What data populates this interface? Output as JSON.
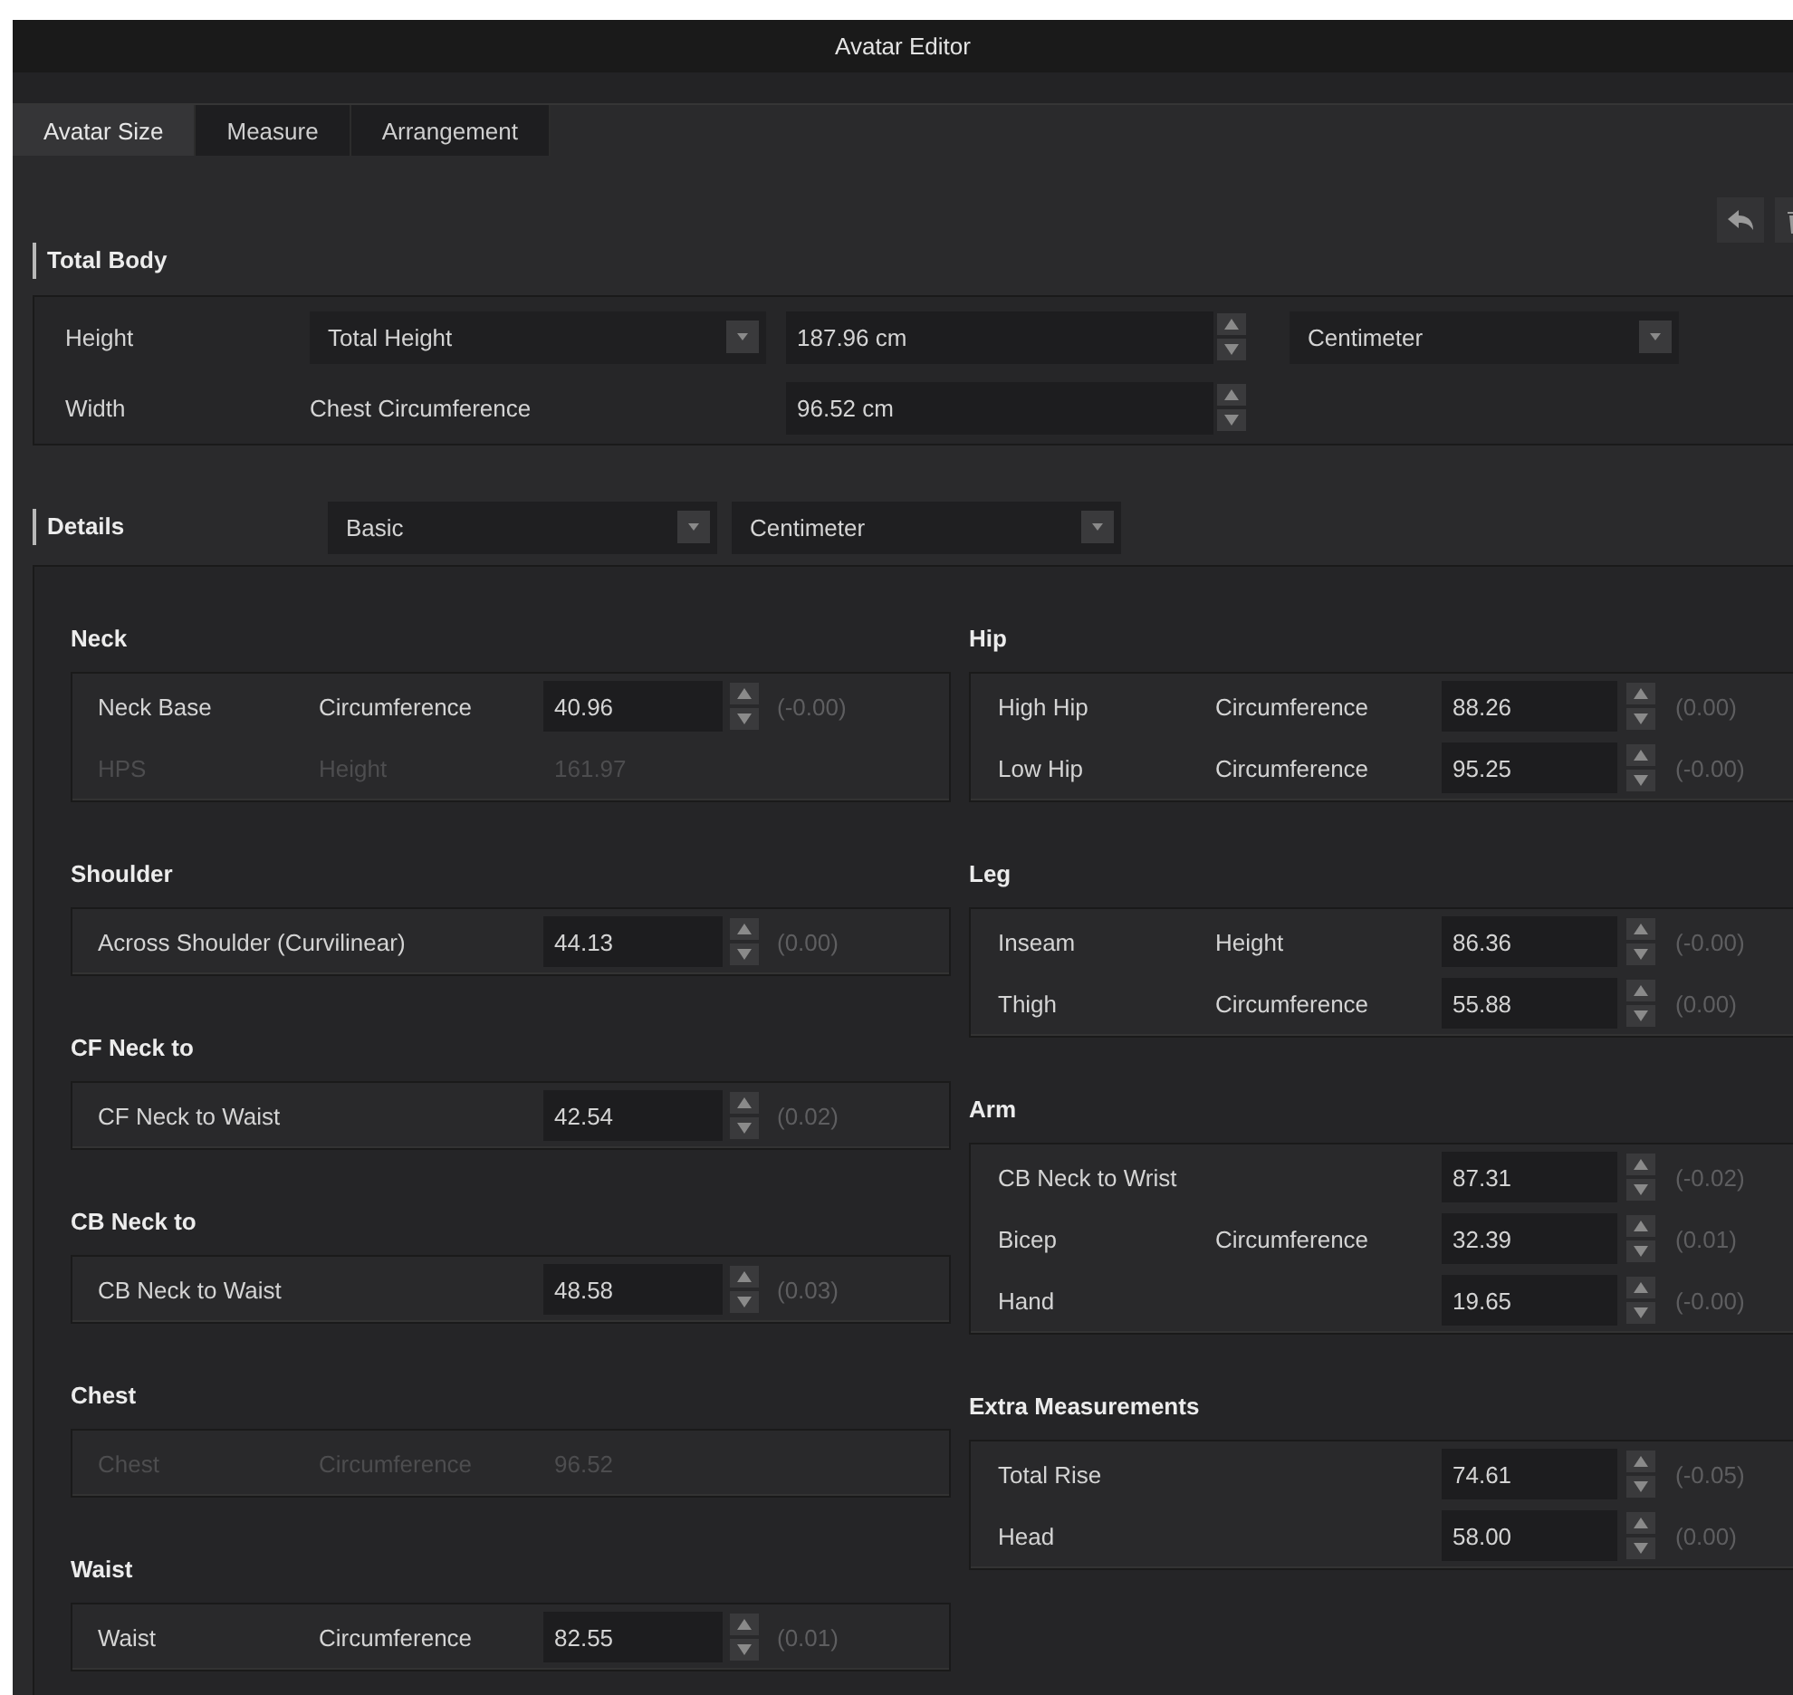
{
  "window": {
    "title": "Avatar Editor"
  },
  "tabs": [
    {
      "label": "Avatar Size",
      "selected": true
    },
    {
      "label": "Measure",
      "selected": false
    },
    {
      "label": "Arrangement",
      "selected": false
    }
  ],
  "total_body": {
    "title": "Total Body",
    "rows": [
      {
        "label": "Height",
        "kind": "dropdown",
        "measure": "Total Height",
        "value": "187.96 cm",
        "unit": "Centimeter"
      },
      {
        "label": "Width",
        "kind": "text",
        "measure": "Chest Circumference",
        "value": "96.52 cm"
      }
    ]
  },
  "details": {
    "title": "Details",
    "preset": "Basic",
    "unit": "Centimeter",
    "left": [
      {
        "title": "Neck",
        "rows": [
          {
            "name": "Neck Base",
            "measure": "Circumference",
            "value": "40.96",
            "delta": "(-0.00)",
            "disabled": false
          },
          {
            "name": "HPS",
            "measure": "Height",
            "value": "161.97",
            "disabled": true
          }
        ]
      },
      {
        "title": "Shoulder",
        "rows": [
          {
            "name": "Across Shoulder (Curvilinear)",
            "value": "44.13",
            "delta": "(0.00)",
            "disabled": false
          }
        ]
      },
      {
        "title": "CF Neck to",
        "rows": [
          {
            "name": "CF Neck to Waist",
            "value": "42.54",
            "delta": "(0.02)",
            "disabled": false
          }
        ]
      },
      {
        "title": "CB Neck to",
        "rows": [
          {
            "name": "CB Neck to Waist",
            "value": "48.58",
            "delta": "(0.03)",
            "disabled": false
          }
        ]
      },
      {
        "title": "Chest",
        "rows": [
          {
            "name": "Chest",
            "measure": "Circumference",
            "value": "96.52",
            "disabled": true
          }
        ]
      },
      {
        "title": "Waist",
        "rows": [
          {
            "name": "Waist",
            "measure": "Circumference",
            "value": "82.55",
            "delta": "(0.01)",
            "disabled": false
          }
        ]
      }
    ],
    "right": [
      {
        "title": "Hip",
        "rows": [
          {
            "name": "High Hip",
            "measure": "Circumference",
            "value": "88.26",
            "delta": "(0.00)",
            "disabled": false
          },
          {
            "name": "Low Hip",
            "measure": "Circumference",
            "value": "95.25",
            "delta": "(-0.00)",
            "disabled": false
          }
        ]
      },
      {
        "title": "Leg",
        "rows": [
          {
            "name": "Inseam",
            "measure": "Height",
            "value": "86.36",
            "delta": "(-0.00)",
            "disabled": false
          },
          {
            "name": "Thigh",
            "measure": "Circumference",
            "value": "55.88",
            "delta": "(0.00)",
            "disabled": false
          }
        ]
      },
      {
        "title": "Arm",
        "rows": [
          {
            "name": "CB Neck to Wrist",
            "value": "87.31",
            "delta": "(-0.02)",
            "disabled": false
          },
          {
            "name": "Bicep",
            "measure": "Circumference",
            "value": "32.39",
            "delta": "(0.01)",
            "disabled": false
          },
          {
            "name": "Hand",
            "value": "19.65",
            "delta": "(-0.00)",
            "disabled": false
          }
        ]
      },
      {
        "title": "Extra Measurements",
        "rows": [
          {
            "name": "Total Rise",
            "value": "74.61",
            "delta": "(-0.05)",
            "disabled": false
          },
          {
            "name": "Head",
            "value": "58.00",
            "delta": "(0.00)",
            "disabled": false
          }
        ]
      }
    ]
  }
}
